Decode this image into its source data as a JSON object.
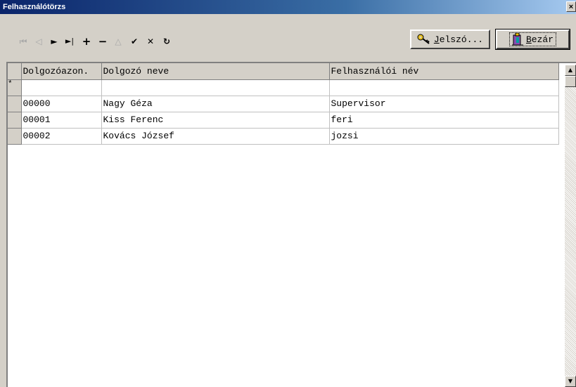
{
  "window": {
    "title": "Felhasználótörzs",
    "close_glyph": "×"
  },
  "nav": {
    "first": "⏮",
    "prior": "◁",
    "next": "►",
    "last": "►|",
    "insert": "+",
    "delete": "−",
    "edit": "△",
    "post": "✔",
    "cancel": "✕",
    "refresh": "↻"
  },
  "buttons": {
    "password": {
      "label_underlined": "J",
      "label_rest": "elszó...",
      "icon": "key-icon"
    },
    "close": {
      "label_underlined": "B",
      "label_rest": "ezár",
      "icon": "door-exit-icon"
    }
  },
  "grid": {
    "columns": [
      "Dolgozóazon.",
      "Dolgozó neve",
      "Felhasználói név"
    ],
    "new_row_marker": "*",
    "rows": [
      [
        "00000",
        "Nagy Géza",
        "Supervisor"
      ],
      [
        "00001",
        "Kiss Ferenc",
        "feri"
      ],
      [
        "00002",
        "Kovács József",
        "jozsi"
      ]
    ]
  },
  "scrollbar": {
    "up": "▲",
    "down": "▼"
  }
}
